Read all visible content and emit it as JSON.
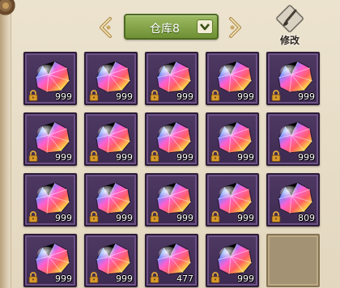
{
  "header": {
    "warehouse_label": "仓库8",
    "edit_label": "修改"
  },
  "icons": {
    "prev": "chevron-left-icon",
    "next": "chevron-right-icon",
    "dropdown": "chevron-down-icon",
    "edit": "brush-icon",
    "item": "rainbow-gem-icon",
    "lock": "lock-icon"
  },
  "colors": {
    "slot_bg": "#3d2a50",
    "select_bg": "#7e9d3f",
    "empty_slot": "#a39273"
  },
  "inventory": {
    "slots": [
      {
        "item": "rainbow-gem",
        "qty": "999",
        "locked": true
      },
      {
        "item": "rainbow-gem",
        "qty": "999",
        "locked": true
      },
      {
        "item": "rainbow-gem",
        "qty": "999",
        "locked": true
      },
      {
        "item": "rainbow-gem",
        "qty": "999",
        "locked": true
      },
      {
        "item": "rainbow-gem",
        "qty": "999",
        "locked": true
      },
      {
        "item": "rainbow-gem",
        "qty": "999",
        "locked": true
      },
      {
        "item": "rainbow-gem",
        "qty": "999",
        "locked": true
      },
      {
        "item": "rainbow-gem",
        "qty": "999",
        "locked": true
      },
      {
        "item": "rainbow-gem",
        "qty": "999",
        "locked": true
      },
      {
        "item": "rainbow-gem",
        "qty": "999",
        "locked": true
      },
      {
        "item": "rainbow-gem",
        "qty": "999",
        "locked": true
      },
      {
        "item": "rainbow-gem",
        "qty": "999",
        "locked": true
      },
      {
        "item": "rainbow-gem",
        "qty": "999",
        "locked": true
      },
      {
        "item": "rainbow-gem",
        "qty": "999",
        "locked": true
      },
      {
        "item": "rainbow-gem",
        "qty": "809",
        "locked": true
      },
      {
        "item": "rainbow-gem",
        "qty": "999",
        "locked": true
      },
      {
        "item": "rainbow-gem",
        "qty": "999",
        "locked": true
      },
      {
        "item": "rainbow-gem",
        "qty": "477",
        "locked": true
      },
      {
        "item": "rainbow-gem",
        "qty": "999",
        "locked": true
      },
      {
        "item": null,
        "qty": null,
        "locked": false
      }
    ]
  }
}
